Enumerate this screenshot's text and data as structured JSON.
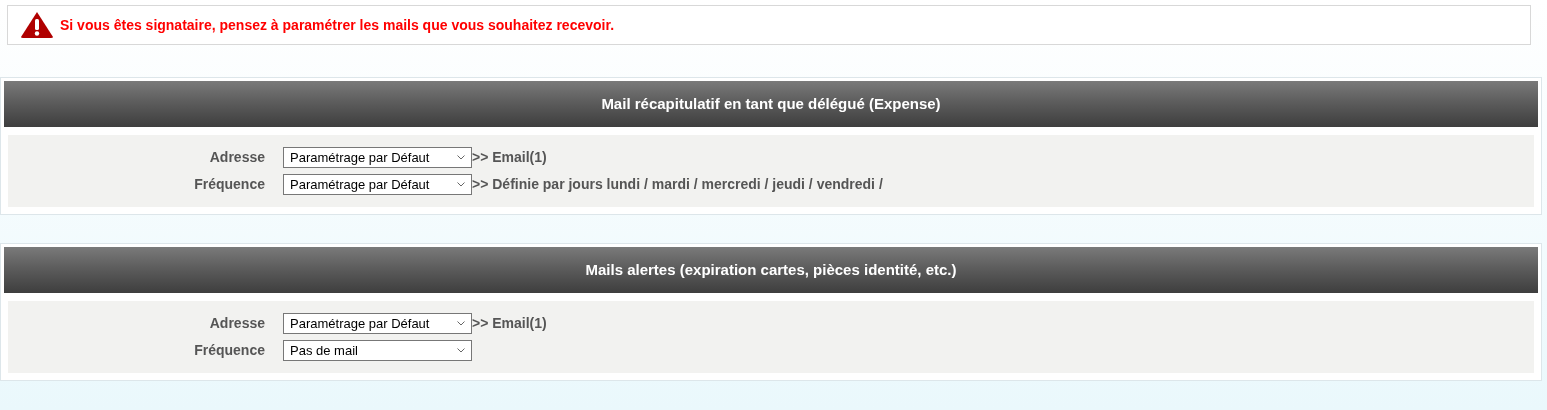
{
  "alert": {
    "text": "Si vous êtes signataire, pensez à paramétrer les mails que vous souhaitez recevoir."
  },
  "sections": [
    {
      "title": "Mail récapitulatif en tant que délégué (Expense)",
      "rows": [
        {
          "label": "Adresse",
          "select": "Paramétrage par Défaut",
          "info": ">> Email(1)"
        },
        {
          "label": "Fréquence",
          "select": "Paramétrage par Défaut",
          "info": ">> Définie par jours lundi / mardi / mercredi / jeudi / vendredi /"
        }
      ]
    },
    {
      "title": "Mails alertes (expiration cartes, pièces identité, etc.)",
      "rows": [
        {
          "label": "Adresse",
          "select": "Paramétrage par Défaut",
          "info": ">> Email(1)"
        },
        {
          "label": "Fréquence",
          "select": "Pas de mail"
        }
      ]
    }
  ]
}
